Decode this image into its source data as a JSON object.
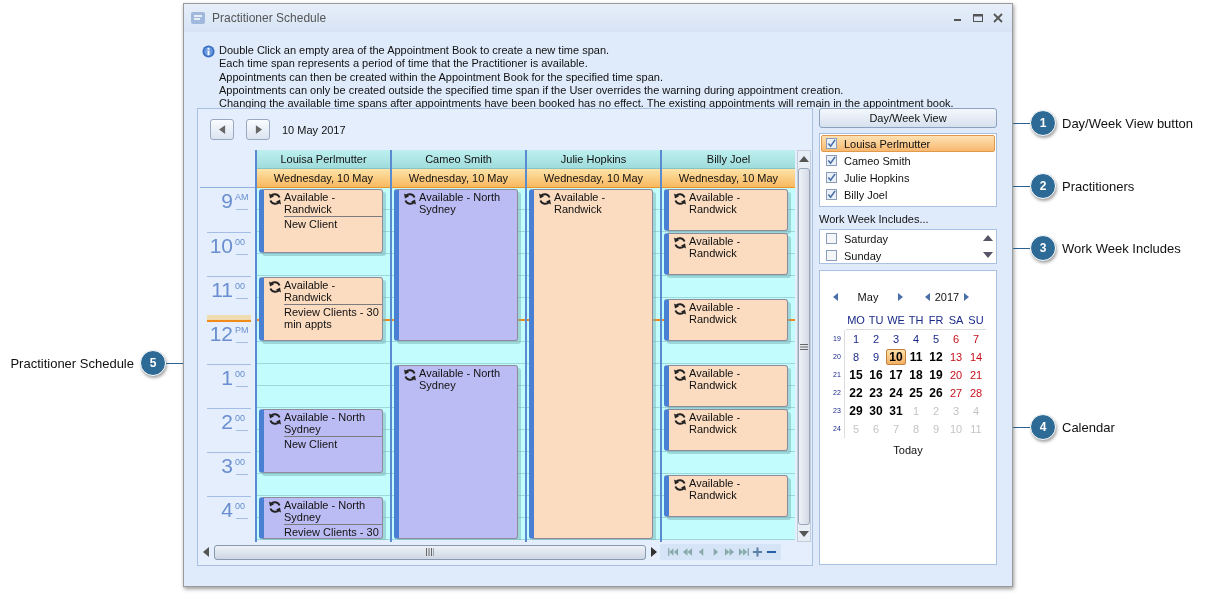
{
  "window": {
    "title": "Practitioner Schedule"
  },
  "info_lines": [
    "Double Click an empty area of the Appointment Book to create a new time span.",
    "Each time span represents a period of time that the Practitioner is available.",
    "Appointments can then be created within the Appointment Book for the specified time span.",
    "Appointments can only be created outside the specified time span if the User overrides the warning during appointment creation.",
    "Changing the available time spans after appointments have been booked has no effect.  The existing appointments will remain in the appointment book."
  ],
  "schedule": {
    "date": "10 May 2017",
    "time_labels": [
      {
        "hour": "9",
        "minutes": "AM"
      },
      {
        "hour": "10",
        "minutes": "00"
      },
      {
        "hour": "11",
        "minutes": "00"
      },
      {
        "hour": "12",
        "minutes": "PM"
      },
      {
        "hour": "1",
        "minutes": "00"
      },
      {
        "hour": "2",
        "minutes": "00"
      },
      {
        "hour": "3",
        "minutes": "00"
      },
      {
        "hour": "4",
        "minutes": "00"
      }
    ],
    "practitioners": [
      {
        "name": "Louisa Perlmutter",
        "date_header": "Wednesday, 10 May",
        "appointments": [
          {
            "color": "#fbdcc0",
            "title": "Available - Randwick",
            "note": "New Client"
          },
          {
            "color": "#fbdcc0",
            "title": "Available - Randwick",
            "note": "Review Clients - 30 min appts"
          },
          {
            "color": "#bcbcf4",
            "title": "Available - North Sydney",
            "note": "New Client"
          },
          {
            "color": "#bcbcf4",
            "title": "Available - North Sydney",
            "note": "Review Clients - 30"
          }
        ]
      },
      {
        "name": "Cameo Smith",
        "date_header": "Wednesday, 10 May",
        "appointments": [
          {
            "color": "#bcbcf4",
            "title": "Available - North Sydney"
          },
          {
            "color": "#bcbcf4",
            "title": "Available - North Sydney"
          }
        ]
      },
      {
        "name": "Julie Hopkins",
        "date_header": "Wednesday, 10 May",
        "appointments": [
          {
            "color": "#fbdcc0",
            "title": "Available - Randwick"
          }
        ]
      },
      {
        "name": "Billy Joel",
        "date_header": "Wednesday, 10 May",
        "appointments": [
          {
            "color": "#fbdcc0",
            "title": "Available - Randwick"
          },
          {
            "color": "#fbdcc0",
            "title": "Available - Randwick"
          },
          {
            "color": "#fbdcc0",
            "title": "Available - Randwick"
          },
          {
            "color": "#fbdcc0",
            "title": "Available - Randwick"
          },
          {
            "color": "#fbdcc0",
            "title": "Available - Randwick"
          },
          {
            "color": "#fbdcc0",
            "title": "Available - Randwick"
          }
        ]
      }
    ]
  },
  "day_week_button": "Day/Week View",
  "practitioner_list": [
    {
      "name": "Louisa Perlmutter",
      "checked": true,
      "selected": true
    },
    {
      "name": "Cameo Smith",
      "checked": true,
      "selected": false
    },
    {
      "name": "Julie Hopkins",
      "checked": true,
      "selected": false
    },
    {
      "name": "Billy Joel",
      "checked": true,
      "selected": false
    }
  ],
  "work_week": {
    "label": "Work Week Includes...",
    "days": [
      {
        "name": "Saturday",
        "checked": false
      },
      {
        "name": "Sunday",
        "checked": false
      }
    ]
  },
  "calendar": {
    "month": "May",
    "year": "2017",
    "weekdays": [
      "MO",
      "TU",
      "WE",
      "TH",
      "FR",
      "SA",
      "SU"
    ],
    "today_button": "Today",
    "weeks": [
      {
        "number": "19",
        "days": [
          {
            "day": "1",
            "kind": "plain",
            "selected": false
          },
          {
            "day": "2",
            "kind": "plain",
            "selected": false
          },
          {
            "day": "3",
            "kind": "plain",
            "selected": false
          },
          {
            "day": "4",
            "kind": "plain",
            "selected": false
          },
          {
            "day": "5",
            "kind": "plain",
            "selected": false
          },
          {
            "day": "6",
            "kind": "weekend",
            "selected": false
          },
          {
            "day": "7",
            "kind": "weekend",
            "selected": false
          }
        ]
      },
      {
        "number": "20",
        "days": [
          {
            "day": "8",
            "kind": "plain",
            "selected": false
          },
          {
            "day": "9",
            "kind": "plain",
            "selected": false
          },
          {
            "day": "10",
            "kind": "busy",
            "selected": true
          },
          {
            "day": "11",
            "kind": "busy",
            "selected": false
          },
          {
            "day": "12",
            "kind": "busy",
            "selected": false
          },
          {
            "day": "13",
            "kind": "weekend",
            "selected": false
          },
          {
            "day": "14",
            "kind": "weekend",
            "selected": false
          }
        ]
      },
      {
        "number": "21",
        "days": [
          {
            "day": "15",
            "kind": "busy",
            "selected": false
          },
          {
            "day": "16",
            "kind": "busy",
            "selected": false
          },
          {
            "day": "17",
            "kind": "busy",
            "selected": false
          },
          {
            "day": "18",
            "kind": "busy",
            "selected": false
          },
          {
            "day": "19",
            "kind": "busy",
            "selected": false
          },
          {
            "day": "20",
            "kind": "weekend",
            "selected": false
          },
          {
            "day": "21",
            "kind": "weekend",
            "selected": false
          }
        ]
      },
      {
        "number": "22",
        "days": [
          {
            "day": "22",
            "kind": "busy",
            "selected": false
          },
          {
            "day": "23",
            "kind": "busy",
            "selected": false
          },
          {
            "day": "24",
            "kind": "busy",
            "selected": false
          },
          {
            "day": "25",
            "kind": "busy",
            "selected": false
          },
          {
            "day": "26",
            "kind": "busy",
            "selected": false
          },
          {
            "day": "27",
            "kind": "weekend",
            "selected": false
          },
          {
            "day": "28",
            "kind": "weekend",
            "selected": false
          }
        ]
      },
      {
        "number": "23",
        "days": [
          {
            "day": "29",
            "kind": "busy",
            "selected": false
          },
          {
            "day": "30",
            "kind": "busy",
            "selected": false
          },
          {
            "day": "31",
            "kind": "busy",
            "selected": false
          },
          {
            "day": "1",
            "kind": "other",
            "selected": false
          },
          {
            "day": "2",
            "kind": "other",
            "selected": false
          },
          {
            "day": "3",
            "kind": "other",
            "selected": false
          },
          {
            "day": "4",
            "kind": "other",
            "selected": false
          }
        ]
      },
      {
        "number": "24",
        "days": [
          {
            "day": "5",
            "kind": "other",
            "selected": false
          },
          {
            "day": "6",
            "kind": "other",
            "selected": false
          },
          {
            "day": "7",
            "kind": "other",
            "selected": false
          },
          {
            "day": "8",
            "kind": "other",
            "selected": false
          },
          {
            "day": "9",
            "kind": "other",
            "selected": false
          },
          {
            "day": "10",
            "kind": "other",
            "selected": false
          },
          {
            "day": "11",
            "kind": "other",
            "selected": false
          }
        ]
      }
    ]
  },
  "callouts": [
    {
      "number": "5",
      "label": "Practitioner Schedule",
      "kind": "left"
    },
    {
      "number": "1",
      "label": "Day/Week View button",
      "kind": "right"
    },
    {
      "number": "2",
      "label": "Practitioners",
      "kind": "right"
    },
    {
      "number": "3",
      "label": "Work Week Includes",
      "kind": "right"
    },
    {
      "number": "4",
      "label": "Calendar",
      "kind": "right"
    }
  ]
}
